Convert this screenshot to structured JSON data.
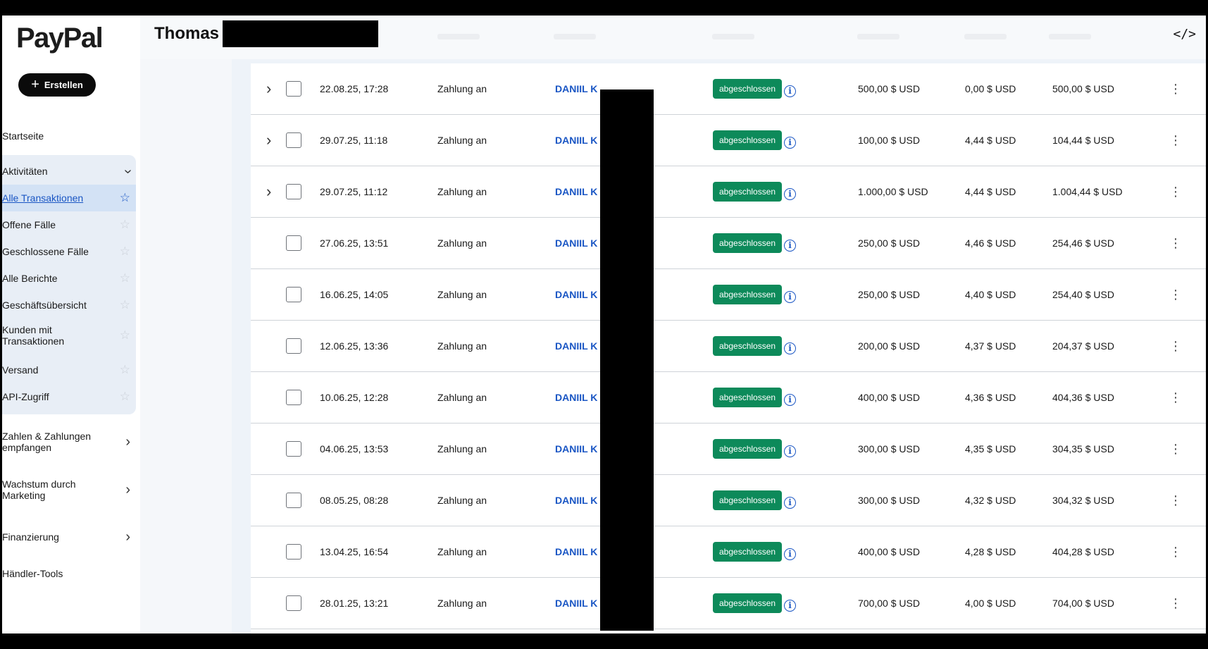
{
  "app": {
    "logo": "PayPal"
  },
  "sidebar": {
    "create_label": "Erstellen",
    "home": "Startseite",
    "activities": "Aktivitäten",
    "activity_items": [
      {
        "label": "Alle Transaktionen",
        "active": true
      },
      {
        "label": "Offene Fälle"
      },
      {
        "label": "Geschlossene Fälle"
      },
      {
        "label": "Alle Berichte"
      },
      {
        "label": "Geschäftsübersicht"
      },
      {
        "label": "Kunden mit Transaktionen"
      },
      {
        "label": "Versand"
      },
      {
        "label": "API-Zugriff"
      }
    ],
    "sections": [
      {
        "label": "Zahlen & Zahlungen empfangen"
      },
      {
        "label": "Wachstum durch Marketing"
      },
      {
        "label": "Finanzierung"
      }
    ],
    "merchant_tools": "Händler-Tools"
  },
  "header": {
    "user_first_name": "Thomas",
    "code_icon": "code-icon"
  },
  "table": {
    "status_label": "abgeschlossen",
    "type_label": "Zahlung an",
    "name_label": "DANIIL K",
    "rows": [
      {
        "date": "22.08.25, 17:28",
        "gross": "500,00 $ USD",
        "fee": "0,00 $ USD",
        "net": "500,00 $ USD",
        "expandable": true
      },
      {
        "date": "29.07.25, 11:18",
        "gross": "100,00 $ USD",
        "fee": "4,44 $ USD",
        "net": "104,44 $ USD",
        "expandable": true
      },
      {
        "date": "29.07.25, 11:12",
        "gross": "1.000,00 $ USD",
        "fee": "4,44 $ USD",
        "net": "1.004,44 $ USD",
        "expandable": true
      },
      {
        "date": "27.06.25, 13:51",
        "gross": "250,00 $ USD",
        "fee": "4,46 $ USD",
        "net": "254,46 $ USD",
        "expandable": false
      },
      {
        "date": "16.06.25, 14:05",
        "gross": "250,00 $ USD",
        "fee": "4,40 $ USD",
        "net": "254,40 $ USD",
        "expandable": false
      },
      {
        "date": "12.06.25, 13:36",
        "gross": "200,00 $ USD",
        "fee": "4,37 $ USD",
        "net": "204,37 $ USD",
        "expandable": false
      },
      {
        "date": "10.06.25, 12:28",
        "gross": "400,00 $ USD",
        "fee": "4,36 $ USD",
        "net": "404,36 $ USD",
        "expandable": false
      },
      {
        "date": "04.06.25, 13:53",
        "gross": "300,00 $ USD",
        "fee": "4,35 $ USD",
        "net": "304,35 $ USD",
        "expandable": false
      },
      {
        "date": "08.05.25, 08:28",
        "gross": "300,00 $ USD",
        "fee": "4,32 $ USD",
        "net": "304,32 $ USD",
        "expandable": false
      },
      {
        "date": "13.04.25, 16:54",
        "gross": "400,00 $ USD",
        "fee": "4,28 $ USD",
        "net": "404,28 $ USD",
        "expandable": false
      },
      {
        "date": "28.01.25, 13:21",
        "gross": "700,00 $ USD",
        "fee": "4,00 $ USD",
        "net": "704,00 $ USD",
        "expandable": false
      }
    ]
  },
  "colors": {
    "accent": "#1a56c4",
    "status_green": "#0d8a5a",
    "active_nav_bg": "#d3e2f5"
  }
}
